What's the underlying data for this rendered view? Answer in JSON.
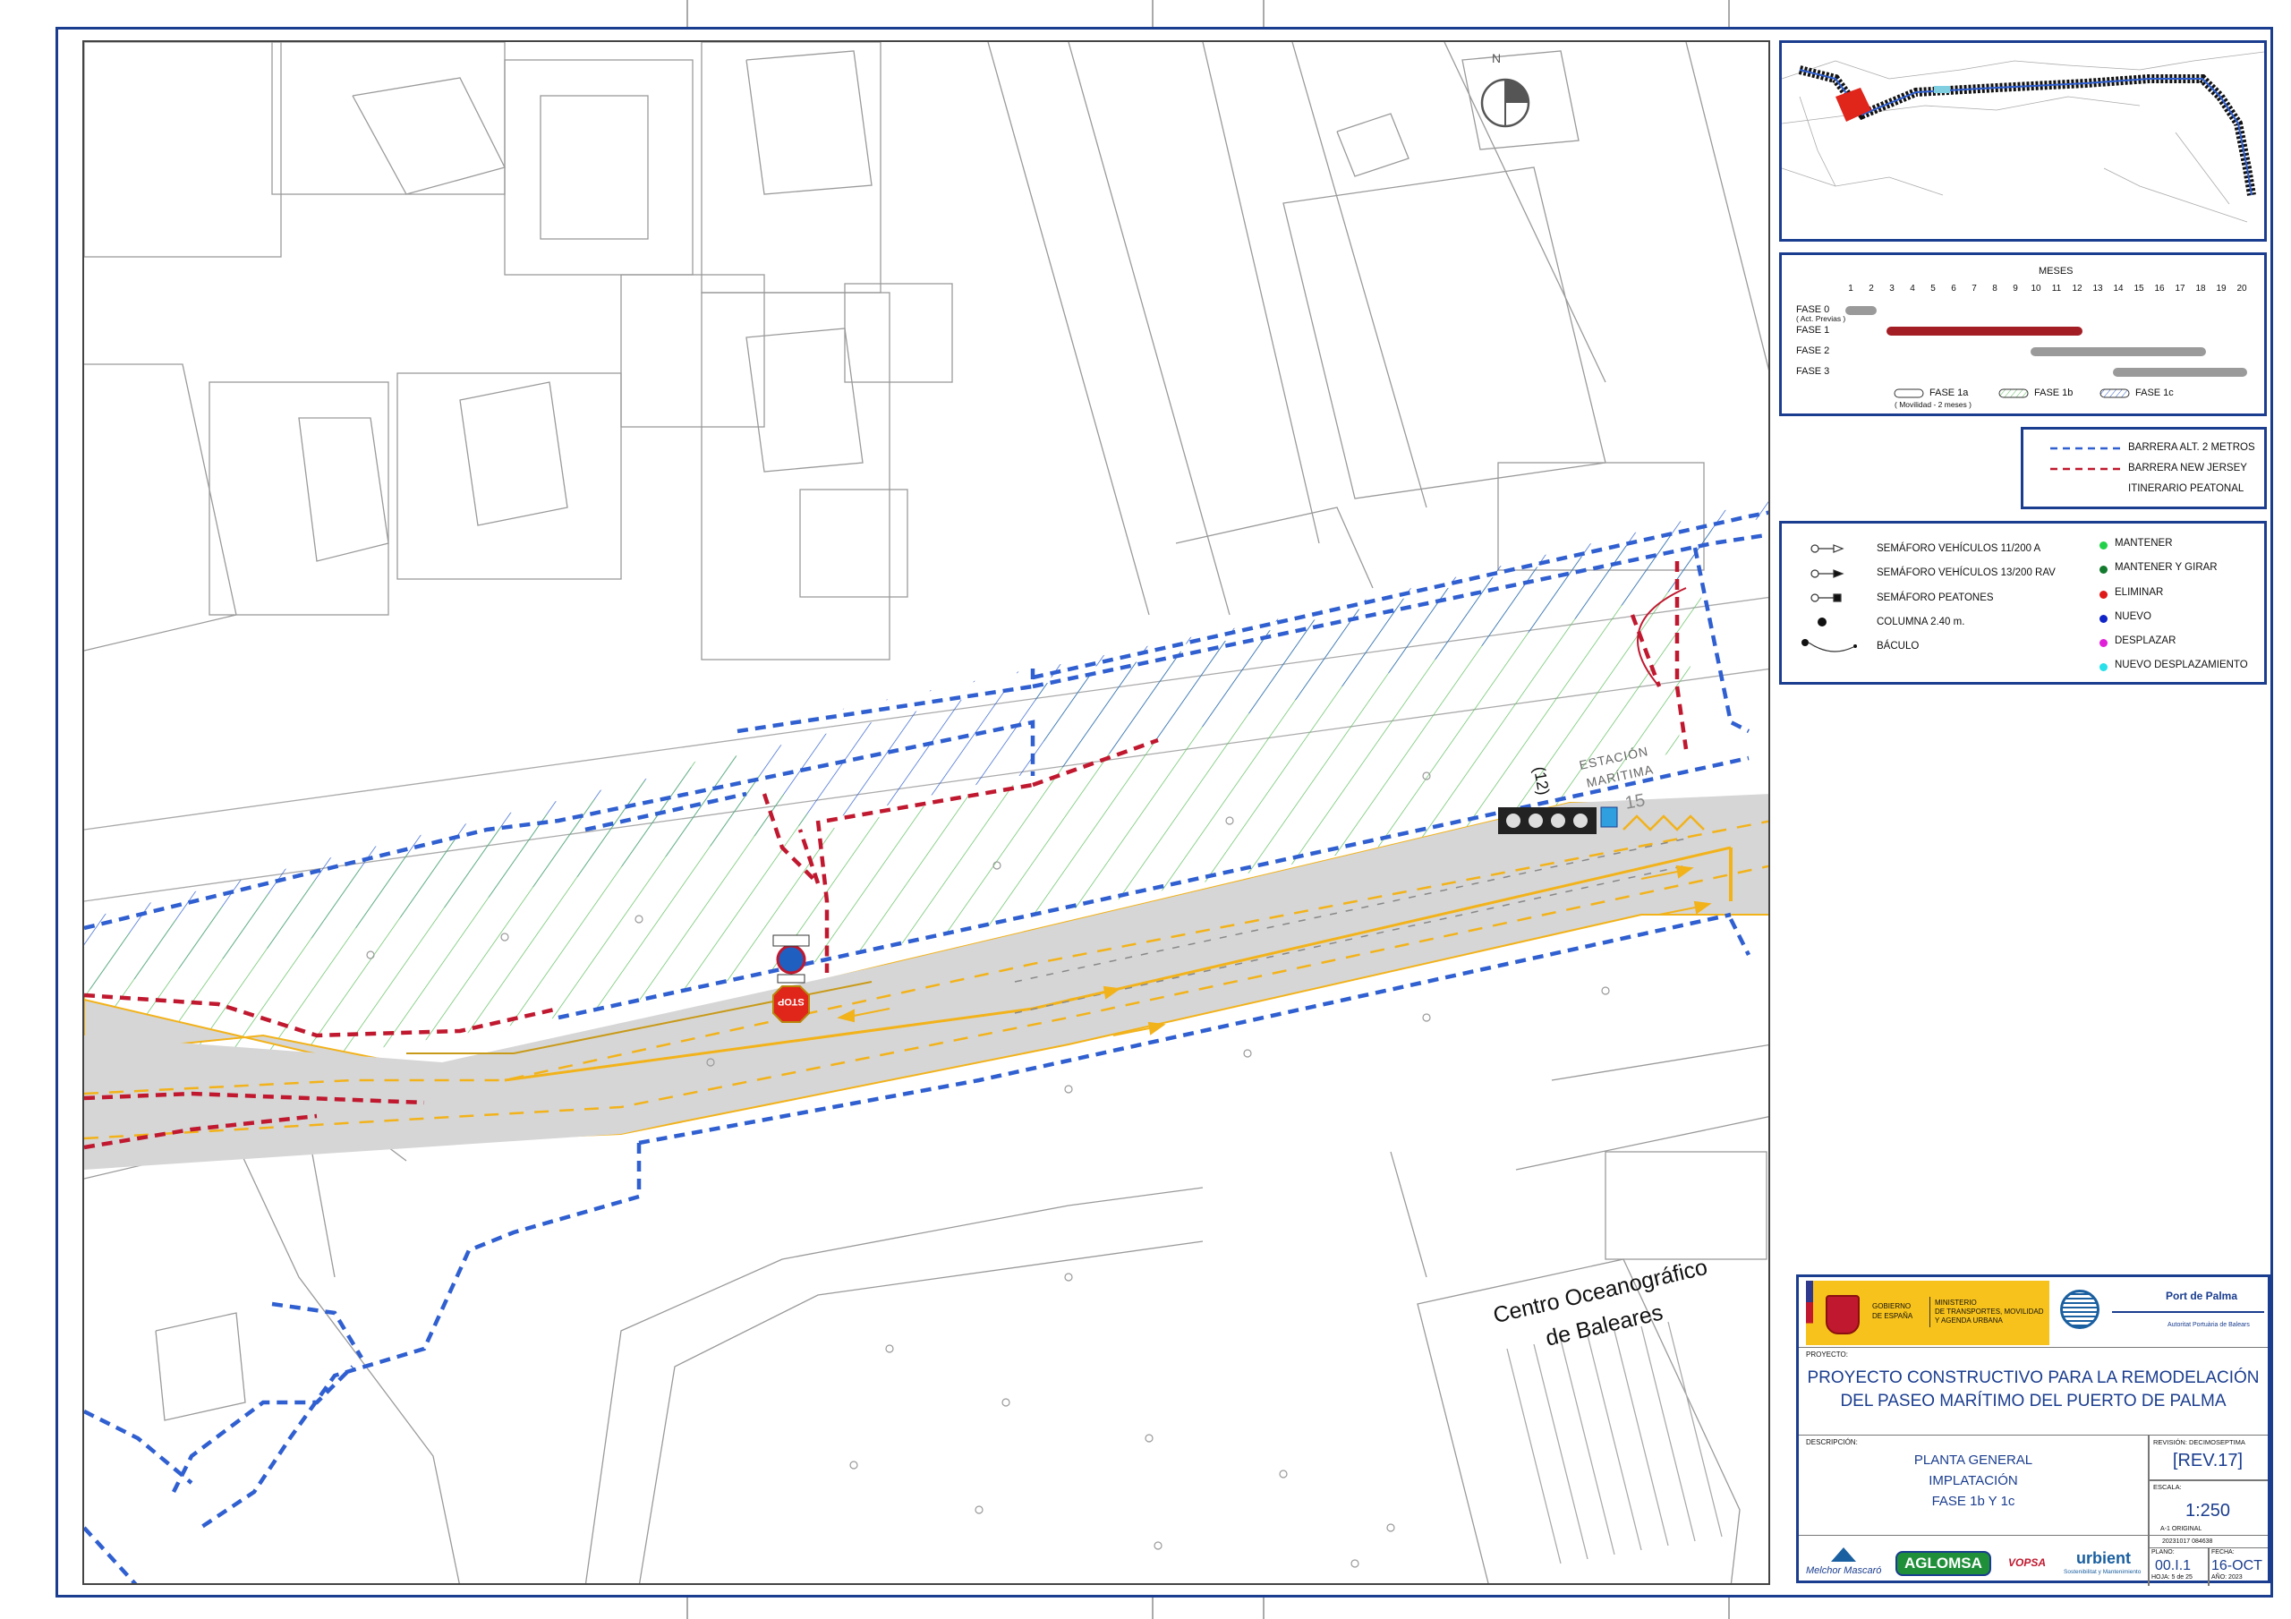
{
  "top_ruler_marks": [
    "",
    "",
    "",
    ""
  ],
  "map": {
    "compass_label": "N",
    "station_label_1": "ESTACIÓN",
    "station_label_2": "MARÍTIMA",
    "traffic_light_id": "(12)",
    "pole_number": "15",
    "stop_sign": "STOP",
    "building_label_1": "Centro Oceanográfico",
    "building_label_2": "de Baleares"
  },
  "gantt": {
    "header": "MESES",
    "months": [
      "1",
      "2",
      "3",
      "4",
      "5",
      "6",
      "7",
      "8",
      "9",
      "10",
      "11",
      "12",
      "13",
      "14",
      "15",
      "16",
      "17",
      "18",
      "19",
      "20"
    ],
    "phases": [
      {
        "label": "FASE 0",
        "sublabel": "( Act. Previas )",
        "start": 1,
        "end": 2,
        "color": "#9a9a9a"
      },
      {
        "label": "FASE 1",
        "sublabel": "",
        "start": 3,
        "end": 12,
        "color": "#a31d24"
      },
      {
        "label": "FASE 2",
        "sublabel": "",
        "start": 10,
        "end": 18,
        "color": "#9a9a9a"
      },
      {
        "label": "FASE 3",
        "sublabel": "",
        "start": 14,
        "end": 20,
        "color": "#9a9a9a"
      }
    ],
    "subphases": [
      {
        "label": "FASE 1a",
        "sublabel": "( Movilidad - 2 meses )"
      },
      {
        "label": "FASE 1b",
        "sublabel": ""
      },
      {
        "label": "FASE 1c",
        "sublabel": ""
      }
    ]
  },
  "barrier_legend": [
    {
      "label": "BARRERA ALT. 2 METROS",
      "color": "#2f5fd0"
    },
    {
      "label": "BARRERA NEW JERSEY",
      "color": "#c0182f"
    },
    {
      "label": "ITINERARIO  PEATONAL",
      "color": ""
    }
  ],
  "symbol_legend": {
    "left": [
      {
        "label": "SEMÁFORO VEHÍCULOS 11/200 A"
      },
      {
        "label": "SEMÁFORO VEHÍCULOS 13/200 RAV"
      },
      {
        "label": "SEMÁFORO PEATONES"
      },
      {
        "label": "COLUMNA 2.40 m."
      },
      {
        "label": "BÁCULO"
      }
    ],
    "right": [
      {
        "label": "MANTENER",
        "color": "#22d14a"
      },
      {
        "label": "MANTENER Y GIRAR",
        "color": "#137a2e"
      },
      {
        "label": "ELIMINAR",
        "color": "#e01919"
      },
      {
        "label": "NUEVO",
        "color": "#1024c8"
      },
      {
        "label": "DESPLAZAR",
        "color": "#e020d8"
      },
      {
        "label": "NUEVO DESPLAZAMIENTO",
        "color": "#27e0ea"
      }
    ]
  },
  "title_block": {
    "gov_1": "GOBIERNO",
    "gov_2": "DE ESPAÑA",
    "ministry_1": "MINISTERIO",
    "ministry_2": "DE TRANSPORTES, MOVILIDAD",
    "ministry_3": "Y AGENDA URBANA",
    "port_name": "Port de Palma",
    "port_authority": "Autoritat Portuària de Balears",
    "project_label": "PROYECTO:",
    "project_title_1": "PROYECTO CONSTRUCTIVO PARA LA REMODELACIÓN",
    "project_title_2": "DEL PASEO MARÍTIMO DEL PUERTO DE PALMA",
    "description_label": "DESCRIPCIÓN:",
    "description_1": "PLANTA GENERAL",
    "description_2": "IMPLATACIÓN",
    "description_3": "FASE 1b Y 1c",
    "revision_label": "REVISIÓN: DECIMOSEPTIMA",
    "revision": "[REV.17]",
    "scale_label": "ESCALA:",
    "scale": "1:250",
    "paper": "A-1 ORIGINAL",
    "file_code": "20231017 084638",
    "plan_label": "PLANO:",
    "plan": "00.I.1",
    "sheet": "HOJA: 5 de 25",
    "date_label": "FECHA:",
    "date": "16-OCT",
    "year": "AÑO: 2023",
    "logo_1": "Melchor Mascaró",
    "logo_2": "AGLOMSA",
    "logo_3": "VOPSA",
    "logo_4": "urbient",
    "logo_4_sub": "Sostenibilitat y Mantenimiento"
  },
  "colors": {
    "frame_blue": "#1a3d8f",
    "blue_barrier": "#2f5fd0",
    "red_barrier": "#c0182f",
    "hatch_green": "#5fbf5f",
    "hatch_blue": "#2f5fd0",
    "road_gray": "#d6d6d6",
    "lane_yellow": "#f2b21a"
  }
}
